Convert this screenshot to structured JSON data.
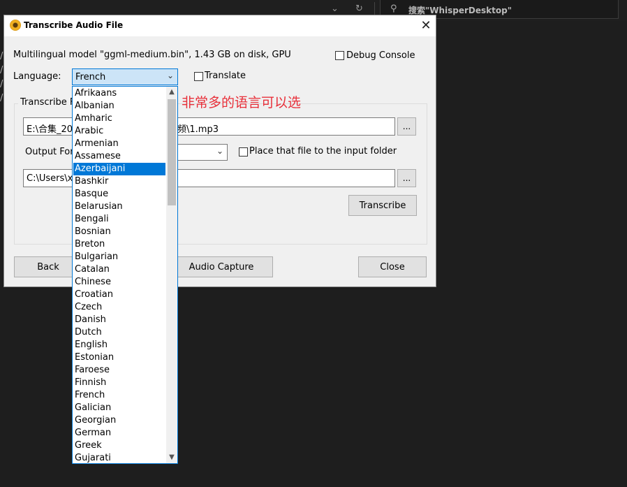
{
  "background": {
    "search_placeholder": "搜索\"WhisperDesktop\"",
    "slashes": [
      "/",
      "/",
      "/",
      "/"
    ]
  },
  "dialog": {
    "title": "Transcribe Audio File",
    "model_info": "Multilingual model \"ggml-medium.bin\", 1.43 GB on disk, GPU",
    "debug_console_label": "Debug Console",
    "language_label": "Language:",
    "language_value": "French",
    "translate_label": "Translate",
    "transcribe_group_label": "Transcribe F",
    "input_path": "E:\\合集_20",
    "input_path_tail": "频\\1.mp3",
    "browse_label": "...",
    "output_format_label": "Output For",
    "place_file_label": "Place that file to the input folder",
    "output_path": "C:\\Users\\x",
    "transcribe_button": "Transcribe",
    "back_button": "Back",
    "audio_capture_button": "Audio Capture",
    "close_button": "Close"
  },
  "annotation": "非常多的语言可以选",
  "language_list": {
    "selected": "Azerbaijani",
    "items": [
      "Afrikaans",
      "Albanian",
      "Amharic",
      "Arabic",
      "Armenian",
      "Assamese",
      "Azerbaijani",
      "Bashkir",
      "Basque",
      "Belarusian",
      "Bengali",
      "Bosnian",
      "Breton",
      "Bulgarian",
      "Catalan",
      "Chinese",
      "Croatian",
      "Czech",
      "Danish",
      "Dutch",
      "English",
      "Estonian",
      "Faroese",
      "Finnish",
      "French",
      "Galician",
      "Georgian",
      "German",
      "Greek",
      "Gujarati"
    ]
  },
  "colors": {
    "accent": "#0078d7",
    "annotation": "#e8303a"
  }
}
